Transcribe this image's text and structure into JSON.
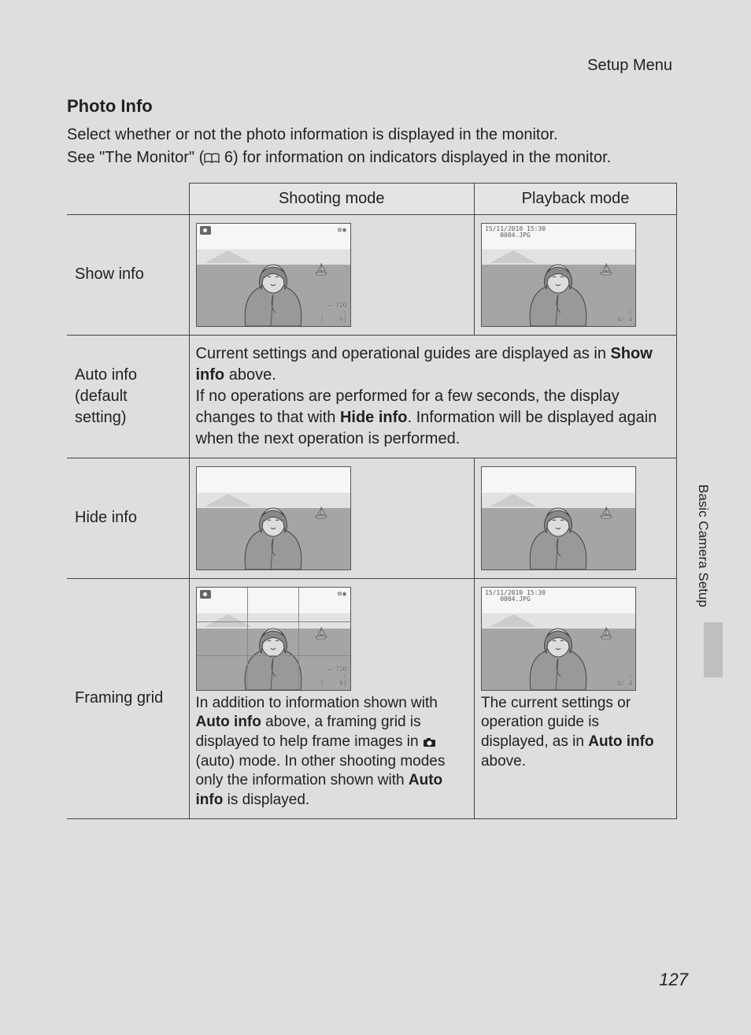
{
  "header": {
    "breadcrumb": "Setup Menu"
  },
  "section": {
    "title": "Photo Info",
    "intro_line1": "Select whether or not the photo information is displayed in the monitor.",
    "intro_line2_pre": "See \"The Monitor\" (",
    "intro_line2_ref": " 6) for information on indicators displayed in the monitor."
  },
  "table": {
    "col_shooting": "Shooting mode",
    "col_playback": "Playback mode",
    "rows": {
      "show_info": {
        "label": "Show info",
        "playback_overlay": {
          "datetime": "15/11/2010 15:30",
          "filename": "0004.JPG",
          "counter": "4/    4"
        },
        "shooting_overlay": {
          "resolution": "720",
          "remaining": "9"
        }
      },
      "auto_info": {
        "label_line1": "Auto info",
        "label_line2": "(default setting)",
        "desc_pre": "Current settings and operational guides are displayed as in ",
        "desc_bold1": "Show info",
        "desc_mid1": " above.",
        "desc_line2_pre": "If no operations are performed for a few seconds, the display changes to that with ",
        "desc_bold2": "Hide info",
        "desc_line2_post": ". Information will be displayed again when the next operation is performed."
      },
      "hide_info": {
        "label": "Hide info"
      },
      "framing_grid": {
        "label": "Framing grid",
        "shooting_caption_pre": "In addition to information shown with ",
        "shooting_caption_b1": "Auto info",
        "shooting_caption_mid1": " above, a framing grid is displayed to help frame images in ",
        "shooting_caption_mid2": " (auto) mode. In other shooting modes only the information shown with ",
        "shooting_caption_b2": "Auto info",
        "shooting_caption_post": " is displayed.",
        "playback_caption_pre": "The current settings or operation guide is displayed, as in ",
        "playback_caption_b1": "Auto info",
        "playback_caption_post": " above.",
        "playback_overlay": {
          "datetime": "15/11/2010 15:30",
          "filename": "0004.JPG",
          "counter": "4/    4"
        },
        "shooting_overlay": {
          "resolution": "720",
          "remaining": "9"
        }
      }
    }
  },
  "side": {
    "label": "Basic Camera Setup"
  },
  "page": {
    "number": "127"
  }
}
